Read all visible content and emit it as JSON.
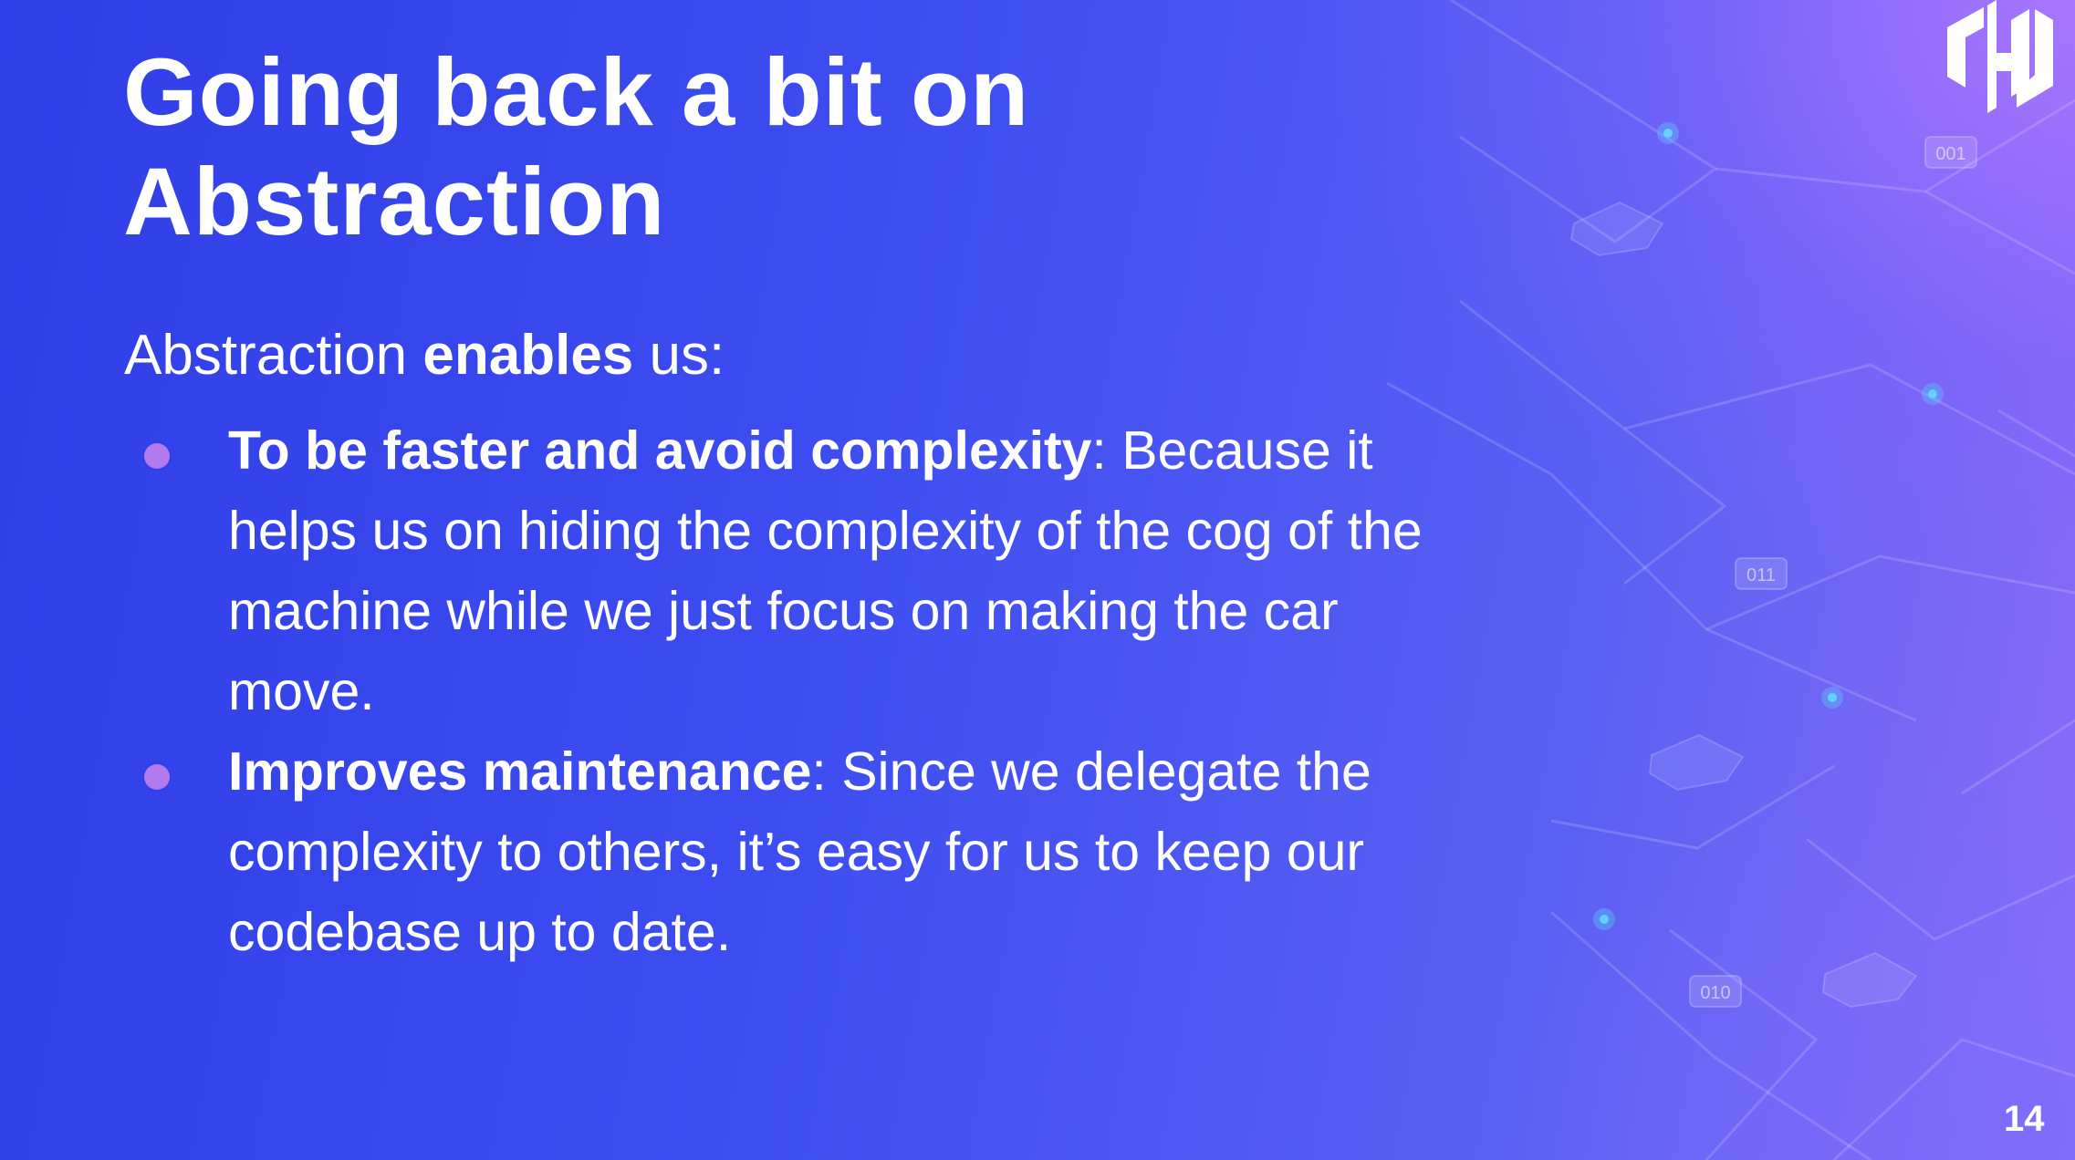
{
  "slide": {
    "title_line1": "Going back a bit on",
    "title_line2": "Abstraction",
    "intro": {
      "prefix": "Abstraction ",
      "bold": "enables",
      "suffix": " us:"
    },
    "bullets": [
      {
        "bold": "To be faster and avoid complexity",
        "text": ": Because it helps us on hiding the complexity of the cog of the machine while we just focus on making the car move."
      },
      {
        "bold": "Improves maintenance",
        "text": ": Since we delegate the complexity to others, it’s easy for us to keep our codebase up to date."
      }
    ],
    "page_number": "14",
    "bullet_color": "#b27bf0"
  },
  "background": {
    "tags": [
      "001",
      "011",
      "010"
    ],
    "glow_color": "#5fd3ff",
    "logo_icon": "hashicorp-logo-icon"
  }
}
